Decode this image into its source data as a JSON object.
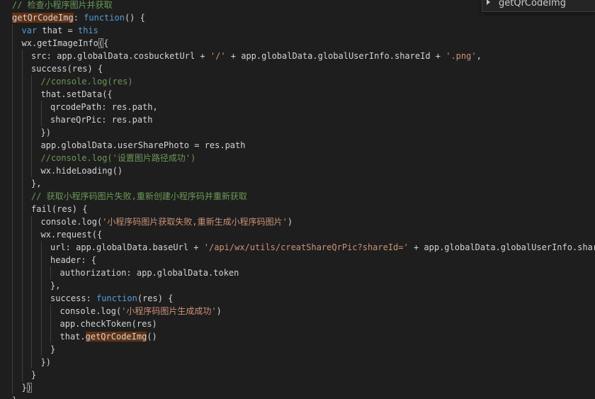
{
  "editor": {
    "lines": [
      {
        "indent": 0,
        "tokens": [
          [
            "cm",
            "// 检查小程序图片并获取"
          ]
        ]
      },
      {
        "indent": 0,
        "tokens": [
          [
            "hl",
            "getQrCodeImg"
          ],
          [
            "p",
            ": "
          ],
          [
            "kw",
            "function"
          ],
          [
            "p",
            "() {"
          ]
        ]
      },
      {
        "indent": 1,
        "tokens": [
          [
            "kw",
            "var"
          ],
          [
            "p",
            " that = "
          ],
          [
            "kw",
            "this"
          ]
        ]
      },
      {
        "indent": 1,
        "tokens": [
          [
            "p",
            "wx.getImageInfo"
          ],
          [
            "br",
            "("
          ],
          [
            "p",
            "{"
          ]
        ]
      },
      {
        "indent": 2,
        "tokens": [
          [
            "p",
            "src: app.globalData.cosbucketUrl + "
          ],
          [
            "str",
            "'/'"
          ],
          [
            "p",
            " + app.globalData.globalUserInfo.shareId + "
          ],
          [
            "str",
            "'.png'"
          ],
          [
            "p",
            ","
          ]
        ]
      },
      {
        "indent": 2,
        "tokens": [
          [
            "p",
            "success(res) {"
          ]
        ]
      },
      {
        "indent": 3,
        "tokens": [
          [
            "cm",
            "//console.log(res)"
          ]
        ]
      },
      {
        "indent": 3,
        "tokens": [
          [
            "p",
            "that.setData({"
          ]
        ]
      },
      {
        "indent": 4,
        "tokens": [
          [
            "p",
            "qrcodePath: res.path,"
          ]
        ]
      },
      {
        "indent": 4,
        "tokens": [
          [
            "p",
            "shareQrPic: res.path"
          ]
        ]
      },
      {
        "indent": 3,
        "tokens": [
          [
            "p",
            "})"
          ]
        ]
      },
      {
        "indent": 3,
        "tokens": [
          [
            "p",
            "app.globalData.userSharePhoto = res.path"
          ]
        ]
      },
      {
        "indent": 3,
        "tokens": [
          [
            "cm",
            "//console.log('设置图片路径成功')"
          ]
        ]
      },
      {
        "indent": 3,
        "tokens": [
          [
            "p",
            "wx.hideLoading()"
          ]
        ]
      },
      {
        "indent": 2,
        "tokens": [
          [
            "p",
            "},"
          ]
        ]
      },
      {
        "indent": 2,
        "tokens": [
          [
            "cm",
            "// 获取小程序码图片失败,重新创建小程序码并重新获取"
          ]
        ]
      },
      {
        "indent": 2,
        "tokens": [
          [
            "p",
            "fail(res) {"
          ]
        ]
      },
      {
        "indent": 3,
        "tokens": [
          [
            "p",
            "console.log("
          ],
          [
            "str",
            "'小程序码图片获取失败,重新生成小程序码图片'"
          ],
          [
            "p",
            ")"
          ]
        ]
      },
      {
        "indent": 3,
        "tokens": [
          [
            "p",
            "wx.request({"
          ]
        ]
      },
      {
        "indent": 4,
        "tokens": [
          [
            "p",
            "url: app.globalData.baseUrl + "
          ],
          [
            "str",
            "'/api/wx/utils/creatShareQrPic?shareId='"
          ],
          [
            "p",
            " + app.globalData.globalUserInfo.shareId,"
          ]
        ]
      },
      {
        "indent": 4,
        "tokens": [
          [
            "p",
            "header: {"
          ]
        ]
      },
      {
        "indent": 5,
        "tokens": [
          [
            "p",
            "authorization: app.globalData.token"
          ]
        ]
      },
      {
        "indent": 4,
        "tokens": [
          [
            "p",
            "},"
          ]
        ]
      },
      {
        "indent": 4,
        "tokens": [
          [
            "p",
            "success: "
          ],
          [
            "kw",
            "function"
          ],
          [
            "p",
            "(res) {"
          ]
        ]
      },
      {
        "indent": 5,
        "tokens": [
          [
            "p",
            "console.log("
          ],
          [
            "str",
            "'小程序码图片生成成功'"
          ],
          [
            "p",
            ")"
          ]
        ]
      },
      {
        "indent": 5,
        "tokens": [
          [
            "p",
            "app.checkToken(res)"
          ]
        ]
      },
      {
        "indent": 5,
        "tokens": [
          [
            "p",
            "that."
          ],
          [
            "hl",
            "getQrCodeImg"
          ],
          [
            "p",
            "()"
          ]
        ]
      },
      {
        "indent": 4,
        "tokens": [
          [
            "p",
            "}"
          ]
        ]
      },
      {
        "indent": 3,
        "tokens": [
          [
            "p",
            "})"
          ]
        ]
      },
      {
        "indent": 2,
        "tokens": [
          [
            "p",
            "}"
          ]
        ]
      },
      {
        "indent": 1,
        "tokens": [
          [
            "p",
            "}"
          ],
          [
            "br",
            ")"
          ]
        ]
      },
      {
        "indent": 0,
        "tokens": [
          [
            "p",
            "},"
          ]
        ]
      }
    ]
  },
  "outline": {
    "item_label": "getQrCodeImg",
    "arrow_icon": "chevron-right-icon"
  },
  "colors": {
    "background": "#1e1e1e",
    "comment": "#6a9955",
    "keyword": "#569cd6",
    "string": "#ce9178",
    "text": "#d4d4d4",
    "highlight": "#613214"
  }
}
